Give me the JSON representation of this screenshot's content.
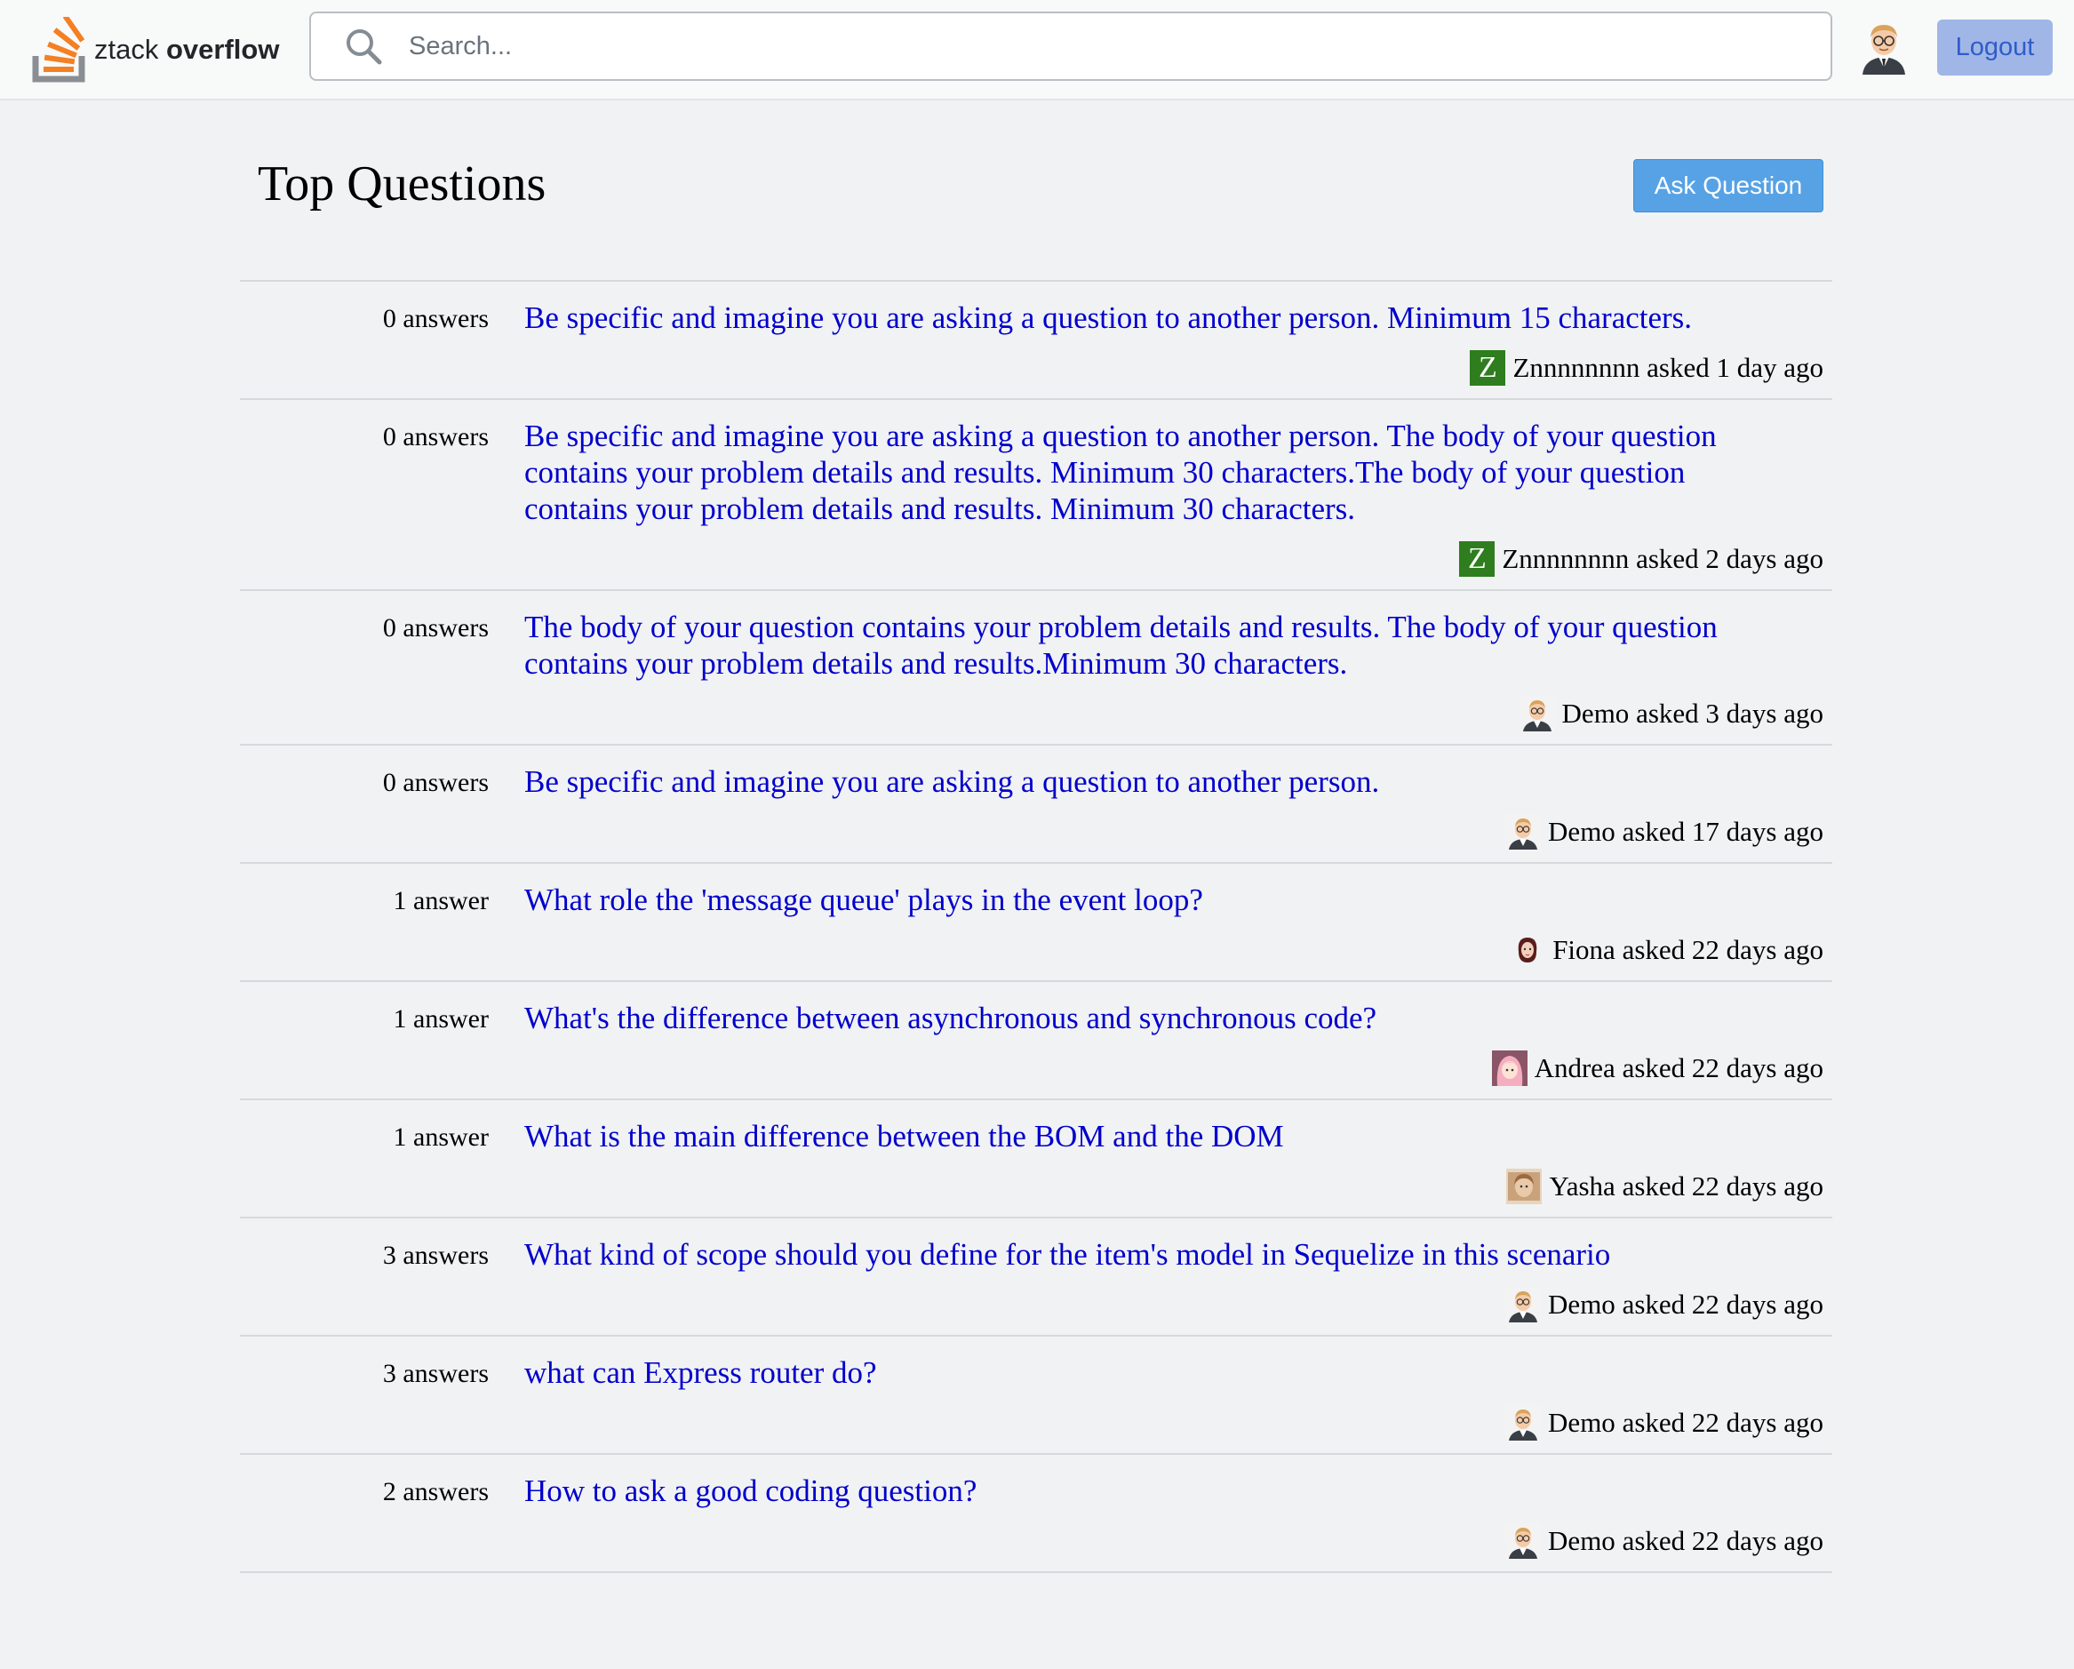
{
  "app": {
    "logo_text_light": "ztack",
    "logo_text_bold": "overflow",
    "accent_color": "#f48024"
  },
  "search": {
    "placeholder": "Search...",
    "value": ""
  },
  "header": {
    "logout_label": "Logout",
    "avatar": "man-with-glasses-avatar"
  },
  "page": {
    "title": "Top Questions",
    "ask_button_label": "Ask Question"
  },
  "questions": [
    {
      "answers": "0 answers",
      "title": "Be specific and imagine you are asking a question to another person. Minimum 15 characters.",
      "author": "Znnnnnnnn",
      "asked_label": " asked ",
      "time": "1 day ago",
      "avatar": "letter-avatar",
      "avatar_letter": "Z"
    },
    {
      "answers": "0 answers",
      "title": "Be specific and imagine you are asking a question to another person. The body of your question contains your problem details and results. Minimum 30 characters.The body of your question contains your problem details and results. Minimum 30 characters.",
      "author": "Znnnnnnnn",
      "asked_label": " asked ",
      "time": "2 days ago",
      "avatar": "letter-avatar",
      "avatar_letter": "Z"
    },
    {
      "answers": "0 answers",
      "title": "The body of your question contains your problem details and results. The body of your question contains your problem details and results.Minimum 30 characters.",
      "author": "Demo",
      "asked_label": " asked ",
      "time": "3 days ago",
      "avatar": "man-with-glasses-avatar"
    },
    {
      "answers": "0 answers",
      "title": "Be specific and imagine you are asking a question to another person.",
      "author": "Demo",
      "asked_label": " asked ",
      "time": "17 days ago",
      "avatar": "man-with-glasses-avatar"
    },
    {
      "answers": "1 answer",
      "title": "What role the 'message queue' plays in the event loop?",
      "author": "Fiona",
      "asked_label": " asked ",
      "time": "22 days ago",
      "avatar": "woman-avatar"
    },
    {
      "answers": "1 answer",
      "title": "What's the difference between asynchronous and synchronous code?",
      "author": "Andrea",
      "asked_label": " asked ",
      "time": "22 days ago",
      "avatar": "pink-hair-avatar"
    },
    {
      "answers": "1 answer",
      "title": "What is the main difference between the BOM and the DOM",
      "author": "Yasha",
      "asked_label": " asked ",
      "time": "22 days ago",
      "avatar": "photo-avatar"
    },
    {
      "answers": "3 answers",
      "title": "What kind of scope should you define for the item's model in Sequelize in this scenario",
      "author": "Demo",
      "asked_label": " asked ",
      "time": "22 days ago",
      "avatar": "man-with-glasses-avatar"
    },
    {
      "answers": "3 answers",
      "title": "what can Express router do?",
      "author": "Demo",
      "asked_label": " asked ",
      "time": "22 days ago",
      "avatar": "man-with-glasses-avatar"
    },
    {
      "answers": "2 answers",
      "title": "How to ask a good coding question?",
      "author": "Demo",
      "asked_label": " asked ",
      "time": "22 days ago",
      "avatar": "man-with-glasses-avatar"
    }
  ]
}
